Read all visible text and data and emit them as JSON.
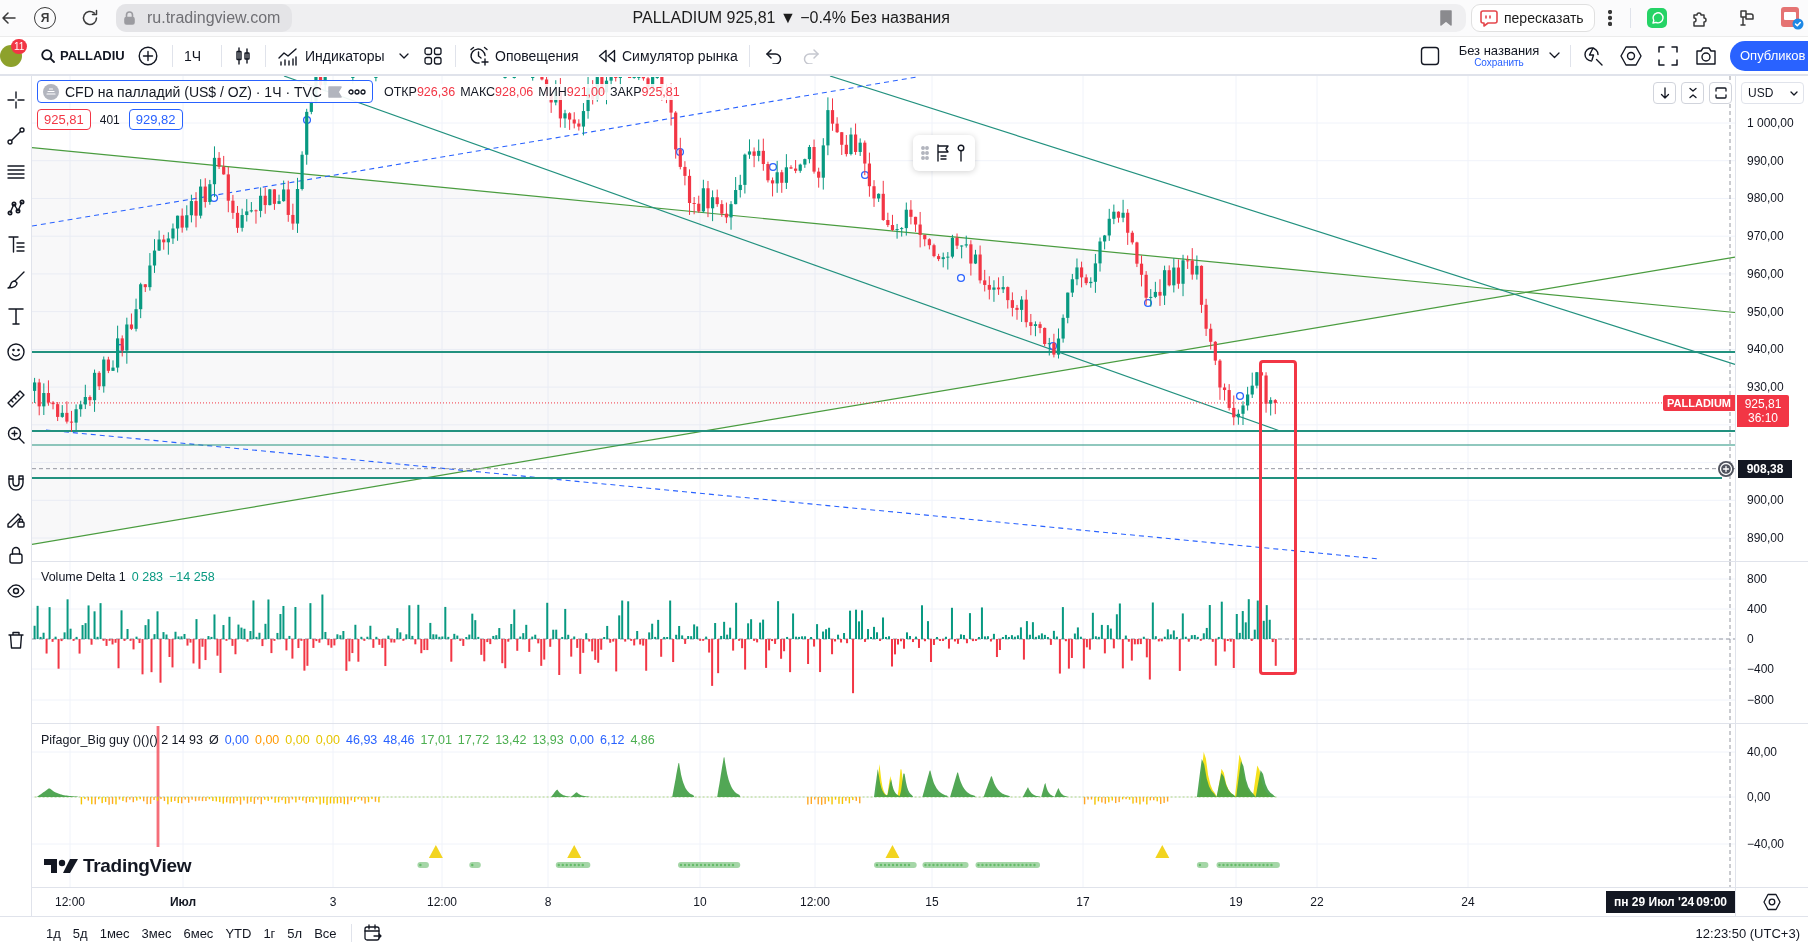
{
  "browser": {
    "home_glyph": "Я",
    "address": "ru.tradingview.com",
    "title": "PALLADIUM 925,81 ▼ −0.4% Без названия",
    "summarize": "пересказать"
  },
  "header": {
    "notifications": "11",
    "symbol": "PALLADIU",
    "interval": "1Ч",
    "indicators": "Индикаторы",
    "alerts": "Оповещения",
    "replay": "Симулятор рынка",
    "layout_name": "Без названия",
    "save_status": "Сохранить",
    "publish": "Опубликов"
  },
  "legend": {
    "title": "CFD на палладий (US$ / OZ) · 1Ч · TVC",
    "ohlc": [
      {
        "label": "ОТКР",
        "value": "926,36"
      },
      {
        "label": "МАКС",
        "value": "928,06"
      },
      {
        "label": "МИН",
        "value": "921,00"
      },
      {
        "label": "ЗАКР",
        "value": "925,81"
      }
    ],
    "sell": "925,81",
    "spread": "401",
    "buy": "929,82"
  },
  "price_axis": {
    "currency": "USD",
    "ticks": [
      "1 000,00",
      "990,00",
      "980,00",
      "970,00",
      "960,00",
      "950,00",
      "940,00",
      "930,00",
      "900,00",
      "890,00"
    ],
    "symbol_tag": "PALLADIUM",
    "last_price": "925,81",
    "countdown": "36:10",
    "crosshair_price": "908,38"
  },
  "volume_delta": {
    "title": "Volume Delta 1",
    "values": [
      "0 283",
      "−14 258"
    ],
    "ticks": [
      "800",
      "400",
      "0",
      "−400",
      "−800"
    ]
  },
  "oscillator": {
    "title": "Pifagor_Big guy ()()() 2 14 93",
    "marker": "Ø",
    "values": [
      {
        "value": "0,00",
        "color": "#2962ff"
      },
      {
        "value": "0,00",
        "color": "#ff9800"
      },
      {
        "value": "0,00",
        "color": "#e6c400"
      },
      {
        "value": "0,00",
        "color": "#e6c400"
      },
      {
        "value": "46,93",
        "color": "#2962ff"
      },
      {
        "value": "48,46",
        "color": "#2962ff"
      },
      {
        "value": "17,01",
        "color": "#4caf50"
      },
      {
        "value": "17,72",
        "color": "#4caf50"
      },
      {
        "value": "13,42",
        "color": "#4caf50"
      },
      {
        "value": "13,93",
        "color": "#4caf50"
      },
      {
        "value": "0,00",
        "color": "#2962ff"
      },
      {
        "value": "6,12",
        "color": "#2962ff"
      },
      {
        "value": "4,86",
        "color": "#4caf50"
      }
    ],
    "ticks": [
      "40,00",
      "0,00",
      "−40,00"
    ]
  },
  "chart_logo": "TradingView",
  "time_axis": {
    "ticks": [
      {
        "label": "12:00",
        "major": false
      },
      {
        "label": "Июл",
        "major": true
      },
      {
        "label": "3",
        "major": false
      },
      {
        "label": "12:00",
        "major": false
      },
      {
        "label": "8",
        "major": false
      },
      {
        "label": "10",
        "major": false
      },
      {
        "label": "12:00",
        "major": false
      },
      {
        "label": "15",
        "major": false
      },
      {
        "label": "17",
        "major": false
      },
      {
        "label": "19",
        "major": false
      },
      {
        "label": "22",
        "major": false
      },
      {
        "label": "24",
        "major": false
      }
    ],
    "crosshair_date": "пн 29 Июл '24",
    "crosshair_time": "09:00"
  },
  "bottom_bar": {
    "ranges": [
      "1д",
      "5д",
      "1мес",
      "3мес",
      "6мес",
      "YTD",
      "1г",
      "5л",
      "Все"
    ],
    "clock": "12:23:50 (UTC+3)"
  }
}
